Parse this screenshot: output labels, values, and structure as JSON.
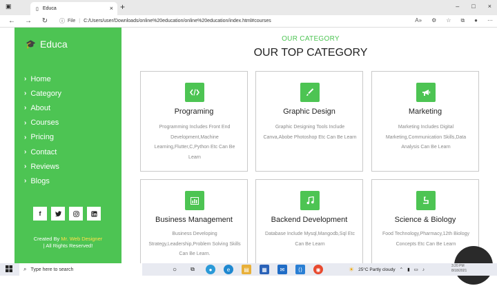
{
  "browser": {
    "tab_title": "Educa",
    "tab_close": "×",
    "new_tab": "+",
    "file_label": "File",
    "url": "C:/Users/user/Downloads/online%20education/online%20education/index.html#courses",
    "window_controls": [
      "–",
      "□",
      "×"
    ]
  },
  "sidebar": {
    "brand": "Educa",
    "menu": [
      {
        "label": "Home"
      },
      {
        "label": "Category"
      },
      {
        "label": "About"
      },
      {
        "label": "Courses"
      },
      {
        "label": "Pricing"
      },
      {
        "label": "Contact"
      },
      {
        "label": "Reviews"
      },
      {
        "label": "Blogs"
      }
    ],
    "socials": [
      "f",
      "t",
      "ig",
      "in"
    ],
    "credit_prefix": "Created By",
    "credit_name": "Mr. Web Designer",
    "credit_suffix": "| All Rights Reserved!"
  },
  "main": {
    "kicker": "OUR CATEGORY",
    "heading": "OUR TOP CATEGORY",
    "cards": [
      {
        "title": "Programing",
        "icon": "code-icon",
        "desc": "Programming Includes Front End Development,Machine Learning,Flutter,C,Python Etc Can Be Learn"
      },
      {
        "title": "Graphic Design",
        "icon": "brush-icon",
        "desc": "Graphic Designing Tools Include Canva,Abobe Photoshop Etc Can Be Learn"
      },
      {
        "title": "Marketing",
        "icon": "megaphone-icon",
        "desc": "Marketing Includes Digital Marketing,Communication Skills,Data Analysis Can Be Learn"
      },
      {
        "title": "Business Management",
        "icon": "chart-icon",
        "desc": "Business Developing Strategy,Leadership,Problem Solving Skills Can Be Learn."
      },
      {
        "title": "Backend Development",
        "icon": "music-icon",
        "desc": "Database Include Mysql,Mangodb,Sql Etc Can Be Learn"
      },
      {
        "title": "Science & Biology",
        "icon": "flask-icon",
        "desc": "Food Technology,Pharmacy,12th Biology Concepts Etc Can Be Learn"
      }
    ]
  },
  "taskbar": {
    "search_placeholder": "Type here to search",
    "weather": "25°C  Partly cloudy",
    "time": "3:20 PM",
    "date": "8/18/2021"
  },
  "colors": {
    "accent": "#4dc453",
    "highlight": "#ffe04a"
  }
}
